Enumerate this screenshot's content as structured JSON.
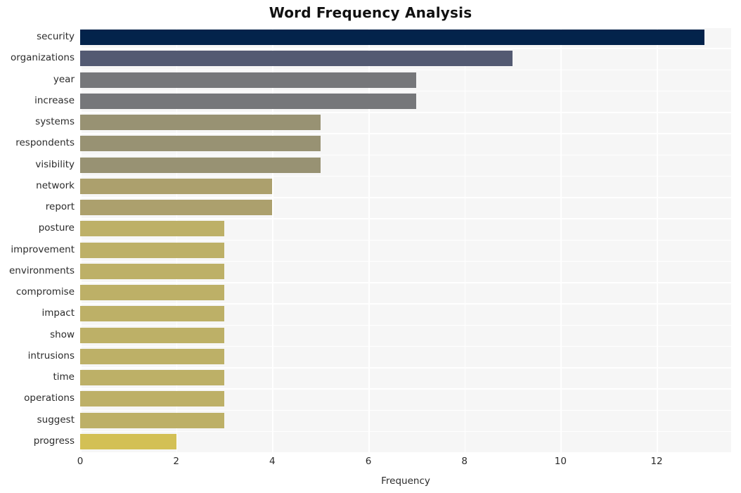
{
  "chart_data": {
    "type": "bar",
    "orientation": "horizontal",
    "title": "Word Frequency Analysis",
    "xlabel": "Frequency",
    "ylabel": "",
    "xlim": [
      0,
      13.55
    ],
    "xticks": [
      0,
      2,
      4,
      6,
      8,
      10,
      12
    ],
    "xtick_labels": [
      "0",
      "2",
      "4",
      "6",
      "8",
      "10",
      "12"
    ],
    "grid": true,
    "legend": null,
    "categories": [
      "security",
      "organizations",
      "year",
      "increase",
      "systems",
      "respondents",
      "visibility",
      "network",
      "report",
      "posture",
      "improvement",
      "environments",
      "compromise",
      "impact",
      "show",
      "intrusions",
      "time",
      "operations",
      "suggest",
      "progress"
    ],
    "values": [
      13,
      9,
      7,
      7,
      5,
      5,
      5,
      4,
      4,
      3,
      3,
      3,
      3,
      3,
      3,
      3,
      3,
      3,
      3,
      2
    ],
    "bar_colors": [
      "#03234b",
      "#535a72",
      "#76777a",
      "#76777a",
      "#989273",
      "#989273",
      "#989273",
      "#aca06d",
      "#aca06d",
      "#bdb067",
      "#bdb067",
      "#bdb067",
      "#bdb067",
      "#bdb067",
      "#bdb067",
      "#bdb067",
      "#bdb067",
      "#bdb067",
      "#bdb067",
      "#d3c055"
    ]
  },
  "style": {
    "plot_background": "#f6f6f6",
    "figure_background": "#ffffff",
    "gridline_color": "#ffffff",
    "text_color": "#2b2b2b",
    "title_color": "#111111"
  }
}
